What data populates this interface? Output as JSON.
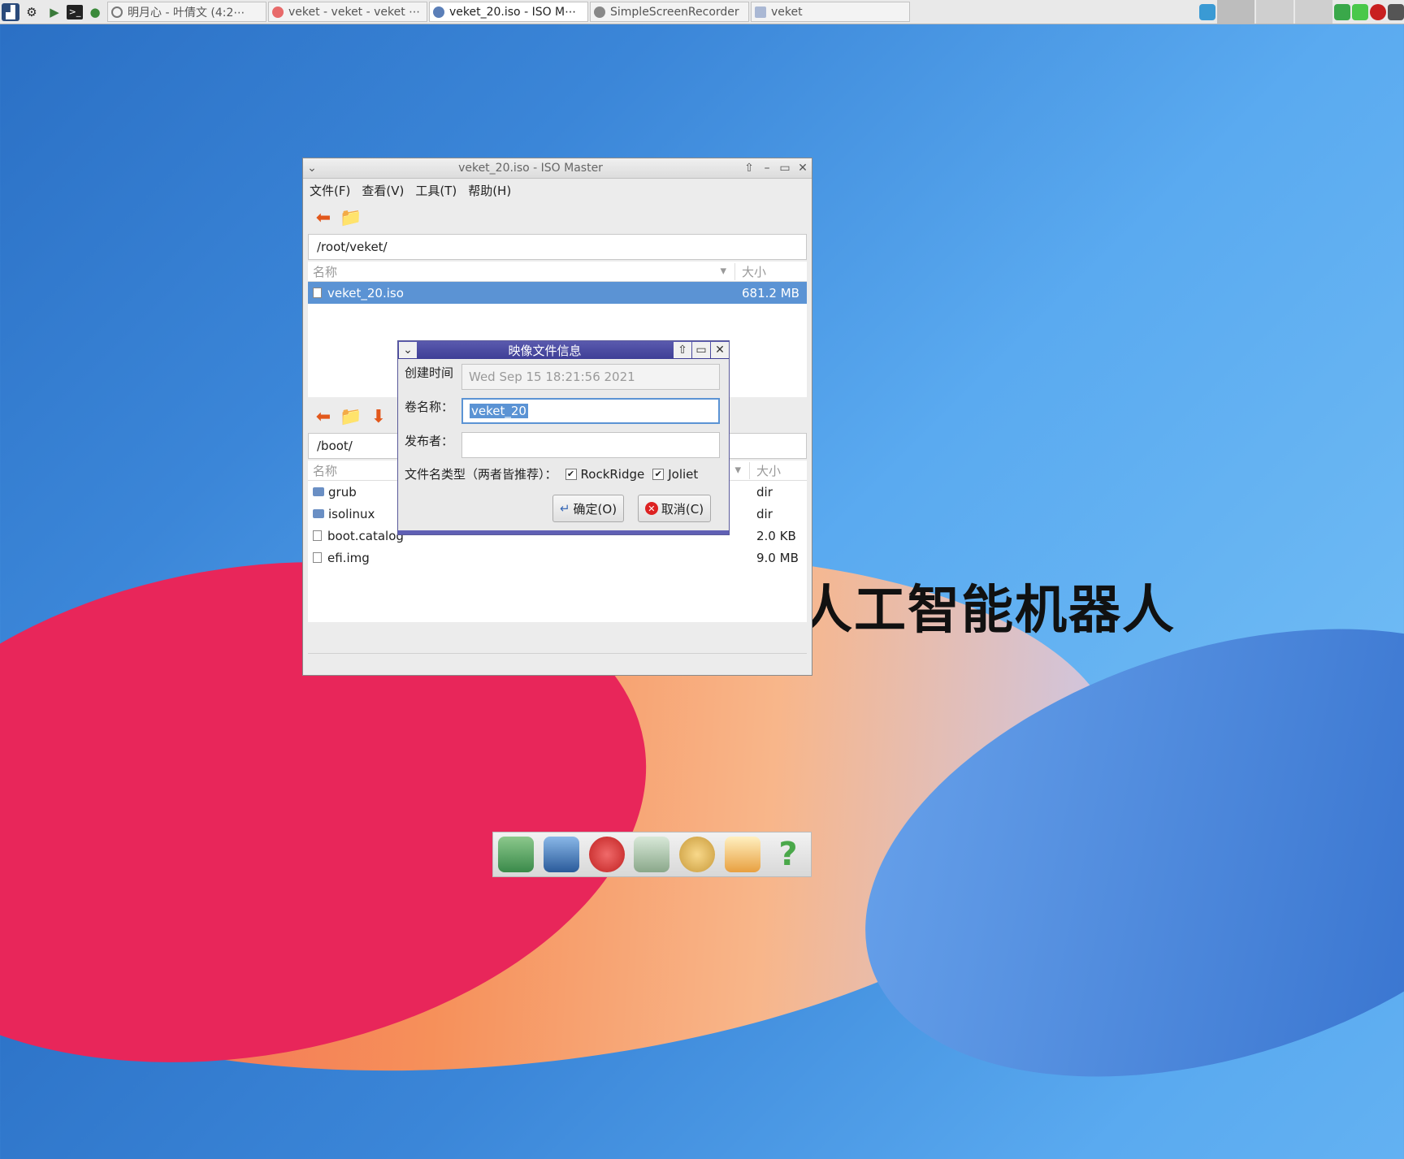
{
  "taskbar": {
    "tasks": [
      {
        "label": "明月心 - 叶倩文 (4:2⋯"
      },
      {
        "label": "veket - veket - veket ⋯"
      },
      {
        "label": "veket_20.iso - ISO M⋯"
      },
      {
        "label": "SimpleScreenRecorder"
      },
      {
        "label": "veket"
      }
    ]
  },
  "desktop": {
    "text": "人工智能机器人"
  },
  "window": {
    "title": "veket_20.iso - ISO Master",
    "menu": [
      "文件(F)",
      "查看(V)",
      "工具(T)",
      "帮助(H)"
    ],
    "top_path": "/root/veket/",
    "col_name": "名称",
    "col_size": "大小",
    "top_files": [
      {
        "name": "veket_20.iso",
        "size": "681.2 MB"
      }
    ],
    "bottom_path": "/boot/",
    "bottom_files": [
      {
        "name": "grub",
        "size": "dir",
        "type": "folder"
      },
      {
        "name": "isolinux",
        "size": "dir",
        "type": "folder"
      },
      {
        "name": "boot.catalog",
        "size": "2.0 KB",
        "type": "file"
      },
      {
        "name": "efi.img",
        "size": "9.0 MB",
        "type": "file"
      }
    ]
  },
  "dialog": {
    "title": "映像文件信息",
    "created_label": "创建时间",
    "created_value": "Wed Sep 15 18:21:56 2021",
    "volume_label": "卷名称：",
    "volume_value": "veket_20",
    "publisher_label": "发布者：",
    "publisher_value": "",
    "filename_types_label": "文件名类型（两者皆推荐）：",
    "rockridge_label": "RockRidge",
    "rockridge_checked": true,
    "joliet_label": "Joliet",
    "joliet_checked": true,
    "ok_label": "确定(O)",
    "cancel_label": "取消(C)"
  }
}
